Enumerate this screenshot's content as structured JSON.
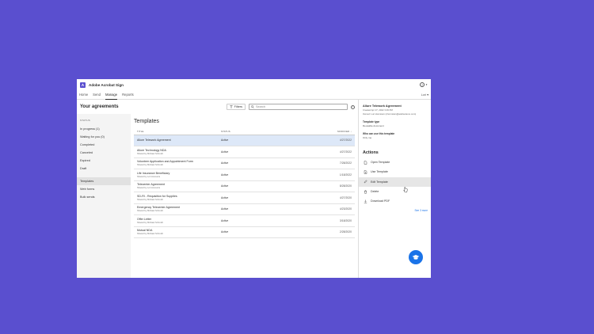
{
  "app": {
    "title": "Adobe Acrobat Sign",
    "user": "Lori"
  },
  "nav": {
    "tabs": [
      "Home",
      "Send",
      "Manage",
      "Reports"
    ],
    "active": 2
  },
  "header": {
    "title": "Your agreements",
    "filters_label": "Filters",
    "search_placeholder": "Search"
  },
  "left": {
    "status_header": "STATUS",
    "items": [
      "In progress (1)",
      "Waiting for you (0)",
      "Completed",
      "Canceled",
      "Expired",
      "Draft"
    ],
    "items2": [
      "Templates",
      "Web forms",
      "Bulk sends"
    ],
    "active": "Templates"
  },
  "center": {
    "title": "Templates",
    "columns": [
      "TITLE",
      "STATUS",
      "MODIFIED"
    ],
    "rows": [
      {
        "name": "Allure Telework Agreement",
        "sub": "",
        "status": "Active",
        "date": "4/27/2022",
        "selected": true
      },
      {
        "name": "Allure Technology NDA",
        "sub": "Shared by Michael Schmidt",
        "status": "Active",
        "date": "4/27/2022"
      },
      {
        "name": "Volunteer Application and Appointment Form",
        "sub": "Shared by Michael Schmidt",
        "status": "Active",
        "date": "7/28/2022"
      },
      {
        "name": "Life Insurance Beneficiary",
        "sub": "Shared by Lori Accounts",
        "status": "Active",
        "date": "1/18/2022"
      },
      {
        "name": "Telecenter Agreement",
        "sub": "Shared by Lori Accounts",
        "status": "Active",
        "date": "8/28/2020"
      },
      {
        "name": "SD-RI - Requisition for Supplies",
        "sub": "Shared by Michael Schmidt",
        "status": "Active",
        "date": "4/27/2020"
      },
      {
        "name": "Emergency Telecenter Agreement",
        "sub": "Shared by Michael Schmidt",
        "status": "Active",
        "date": "4/23/2020"
      },
      {
        "name": "Offer Letter",
        "sub": "Shared by Michael Schmidt",
        "status": "Active",
        "date": "3/18/2020"
      },
      {
        "name": "Mutual NDA",
        "sub": "Shared by Michael Schmidt",
        "status": "Active",
        "date": "2/28/2020"
      }
    ]
  },
  "detail": {
    "title": "Allure Telework Agreement",
    "created": "Created Apr 27, 2022 3:29 PM",
    "owner": "Owned: Lori.Hornstein (nhornstein@adobedemo.com)",
    "type_label": "Template type",
    "type_value": "Reusable document",
    "who_label": "Who can use this template",
    "who_value": "Only me",
    "actions_header": "Actions",
    "actions": [
      "Open Template",
      "Use Template",
      "Edit Template",
      "Delete",
      "Download PDF"
    ],
    "see_more": "See 3 more"
  },
  "icons": [
    "document-icon",
    "play-icon",
    "pencil-icon",
    "trash-icon",
    "download-icon",
    "graduation-cap-icon",
    "search-icon",
    "filter-icon",
    "info-icon",
    "help-icon"
  ],
  "colors": {
    "background": "#5a4fcf",
    "accent": "#1a73e8",
    "selected_row": "#dde8f8"
  }
}
